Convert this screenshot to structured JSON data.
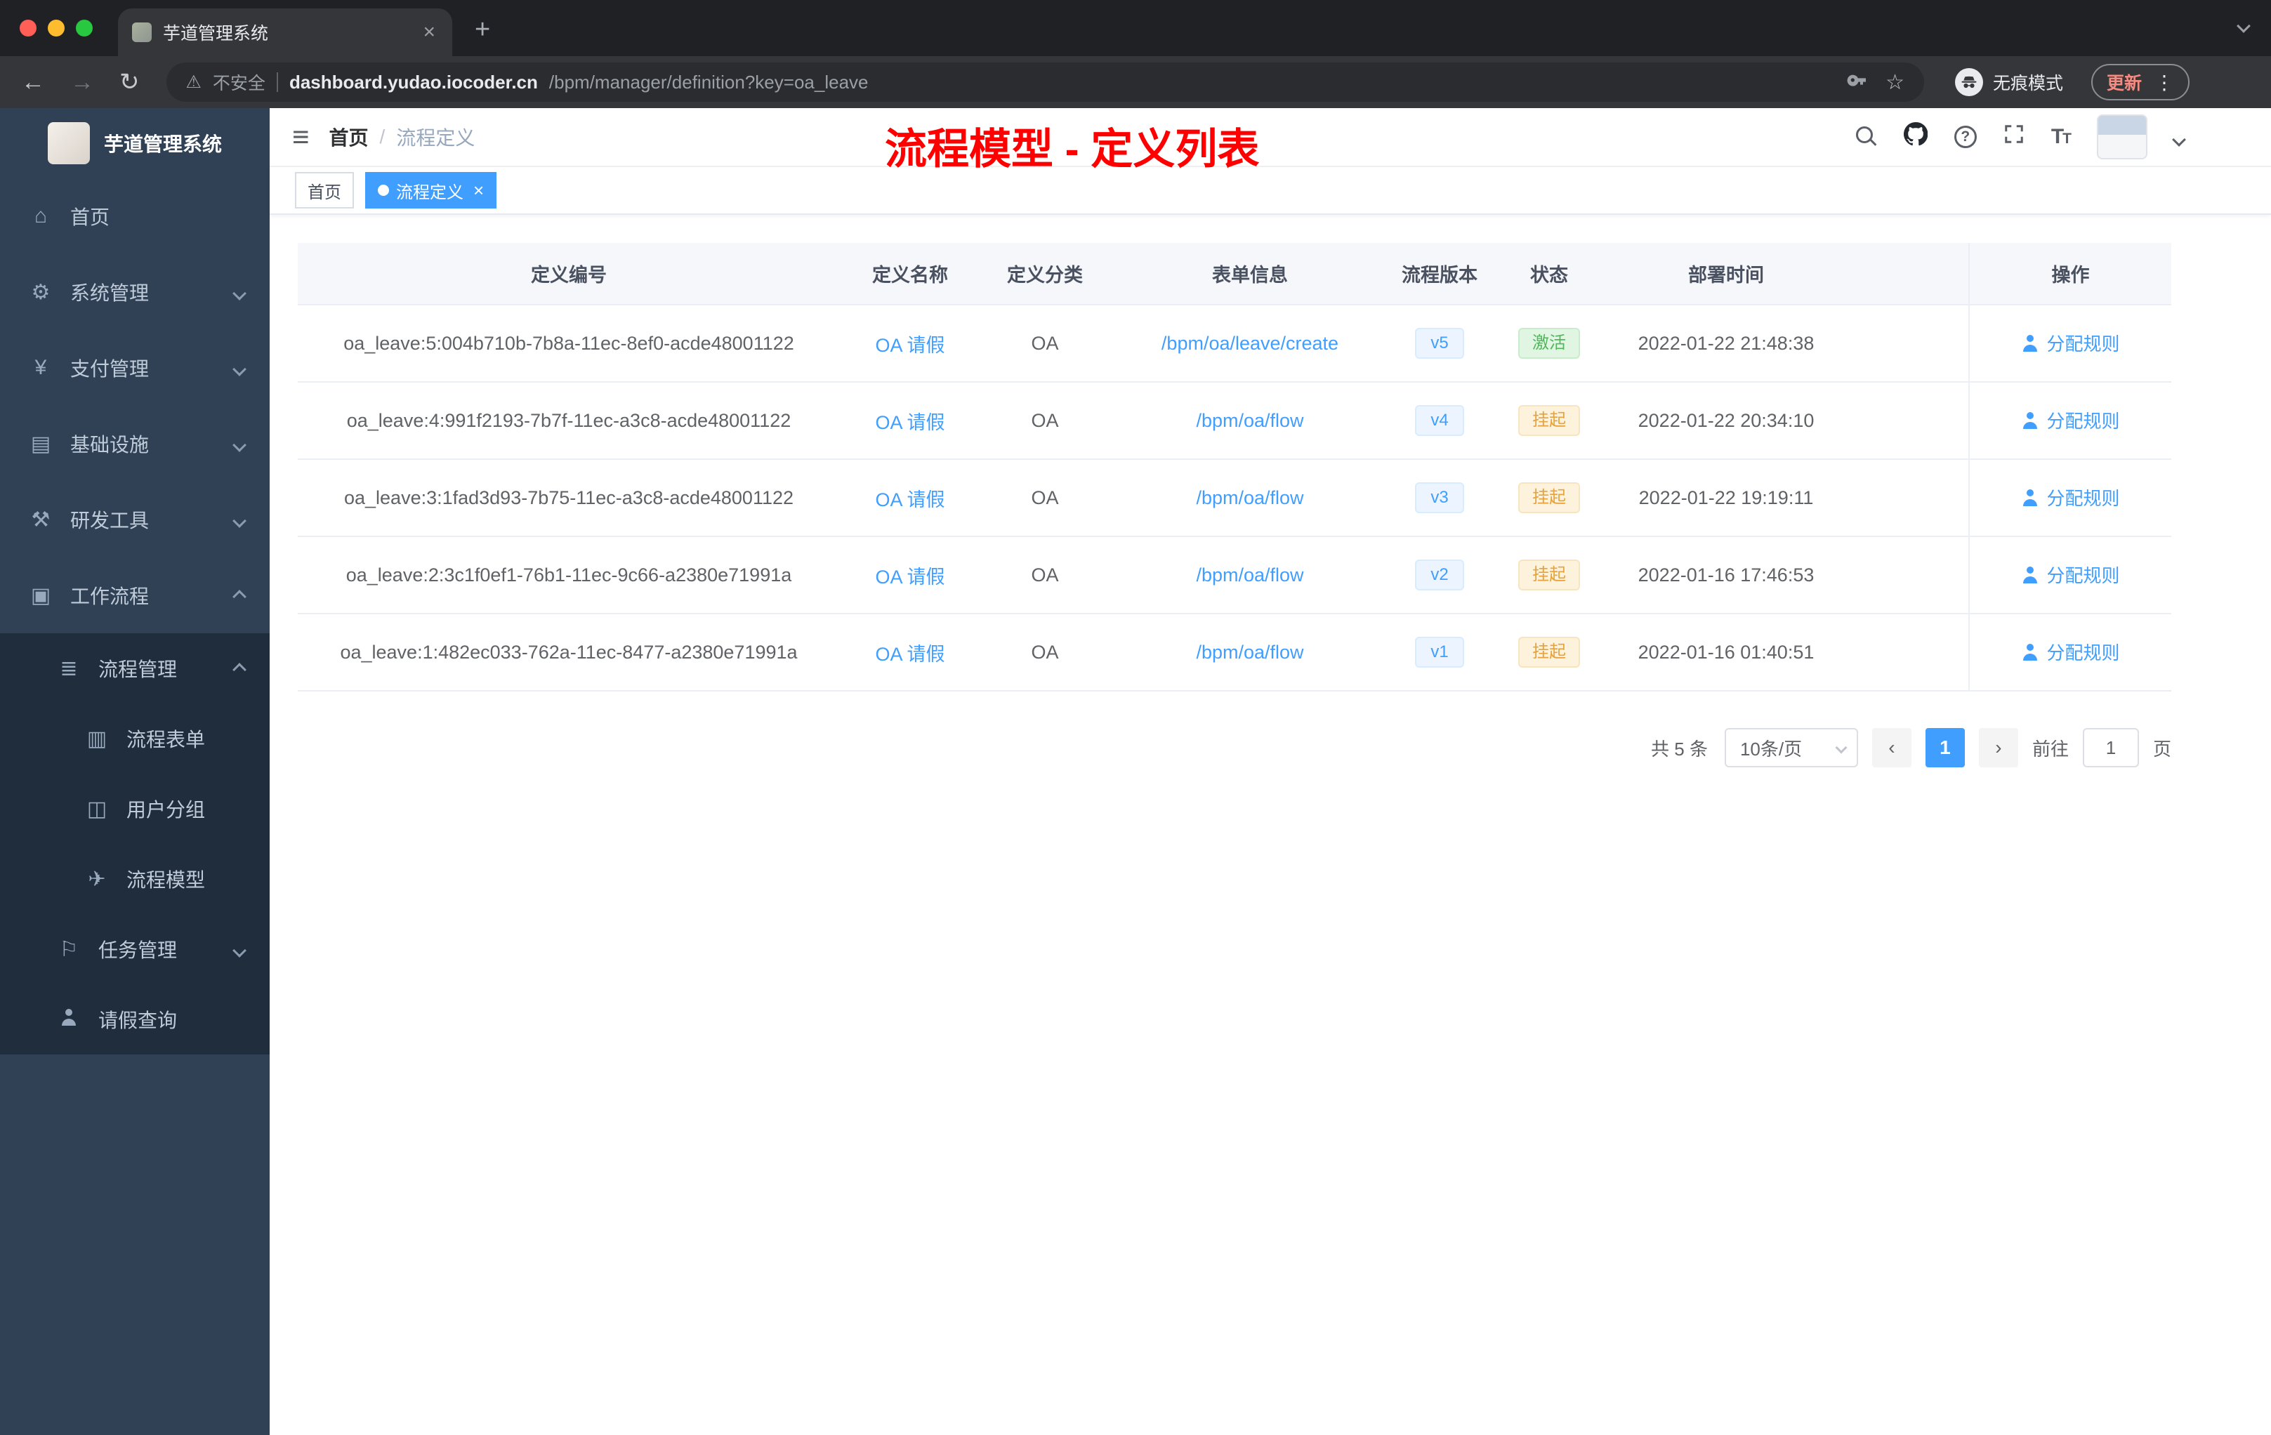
{
  "theme": {
    "accent": "#409eff",
    "success": "#67c23a",
    "warning": "#e6a23c",
    "annotation_red": "#ff0000",
    "sidebar_bg": "#304156",
    "submenu_bg": "#1f2d3d"
  },
  "browser": {
    "tab": {
      "title": "芋道管理系统"
    },
    "toolbar": {
      "security_label": "不安全",
      "url_host": "dashboard.yudao.iocoder.cn",
      "url_path": "/bpm/manager/definition?key=oa_leave",
      "incognito_label": "无痕模式",
      "update_label": "更新"
    }
  },
  "sidebar": {
    "logo_title": "芋道管理系统",
    "items": [
      {
        "label": "首页",
        "icon": "dashboard-icon"
      },
      {
        "label": "系统管理",
        "icon": "gear-icon"
      },
      {
        "label": "支付管理",
        "icon": "yen-icon"
      },
      {
        "label": "基础设施",
        "icon": "infrastructure-icon"
      },
      {
        "label": "研发工具",
        "icon": "dev-tools-icon"
      },
      {
        "label": "工作流程",
        "icon": "workflow-icon"
      },
      {
        "label": "流程管理",
        "icon": "process-list-icon"
      },
      {
        "label": "流程表单",
        "icon": "form-icon"
      },
      {
        "label": "用户分组",
        "icon": "user-group-icon"
      },
      {
        "label": "流程模型",
        "icon": "paper-plane-icon"
      },
      {
        "label": "任务管理",
        "icon": "task-flag-icon"
      },
      {
        "label": "请假查询",
        "icon": "person-icon"
      }
    ]
  },
  "navbar": {
    "breadcrumb": {
      "home": "首页",
      "separator": "/",
      "current": "流程定义"
    }
  },
  "overlay": {
    "title": "流程模型 - 定义列表"
  },
  "tags": {
    "home": "首页",
    "active": "流程定义"
  },
  "table": {
    "columns": [
      "定义编号",
      "定义名称",
      "定义分类",
      "表单信息",
      "流程版本",
      "状态",
      "部署时间",
      "操作"
    ],
    "rows": [
      {
        "id": "oa_leave:5:004b710b-7b8a-11ec-8ef0-acde48001122",
        "name": "OA 请假",
        "category": "OA",
        "form": "/bpm/oa/leave/create",
        "version": "v5",
        "status": "激活",
        "time": "2022-01-22 21:48:38",
        "action": "分配规则"
      },
      {
        "id": "oa_leave:4:991f2193-7b7f-11ec-a3c8-acde48001122",
        "name": "OA 请假",
        "category": "OA",
        "form": "/bpm/oa/flow",
        "version": "v4",
        "status": "挂起",
        "time": "2022-01-22 20:34:10",
        "action": "分配规则"
      },
      {
        "id": "oa_leave:3:1fad3d93-7b75-11ec-a3c8-acde48001122",
        "name": "OA 请假",
        "category": "OA",
        "form": "/bpm/oa/flow",
        "version": "v3",
        "status": "挂起",
        "time": "2022-01-22 19:19:11",
        "action": "分配规则"
      },
      {
        "id": "oa_leave:2:3c1f0ef1-76b1-11ec-9c66-a2380e71991a",
        "name": "OA 请假",
        "category": "OA",
        "form": "/bpm/oa/flow",
        "version": "v2",
        "status": "挂起",
        "time": "2022-01-16 17:46:53",
        "action": "分配规则"
      },
      {
        "id": "oa_leave:1:482ec033-762a-11ec-8477-a2380e71991a",
        "name": "OA 请假",
        "category": "OA",
        "form": "/bpm/oa/flow",
        "version": "v1",
        "status": "挂起",
        "time": "2022-01-16 01:40:51",
        "action": "分配规则"
      }
    ]
  },
  "pagination": {
    "total": "共 5 条",
    "page_size": "10条/页",
    "current_page": "1",
    "goto_label": "前往",
    "goto_value": "1",
    "page_unit": "页"
  }
}
